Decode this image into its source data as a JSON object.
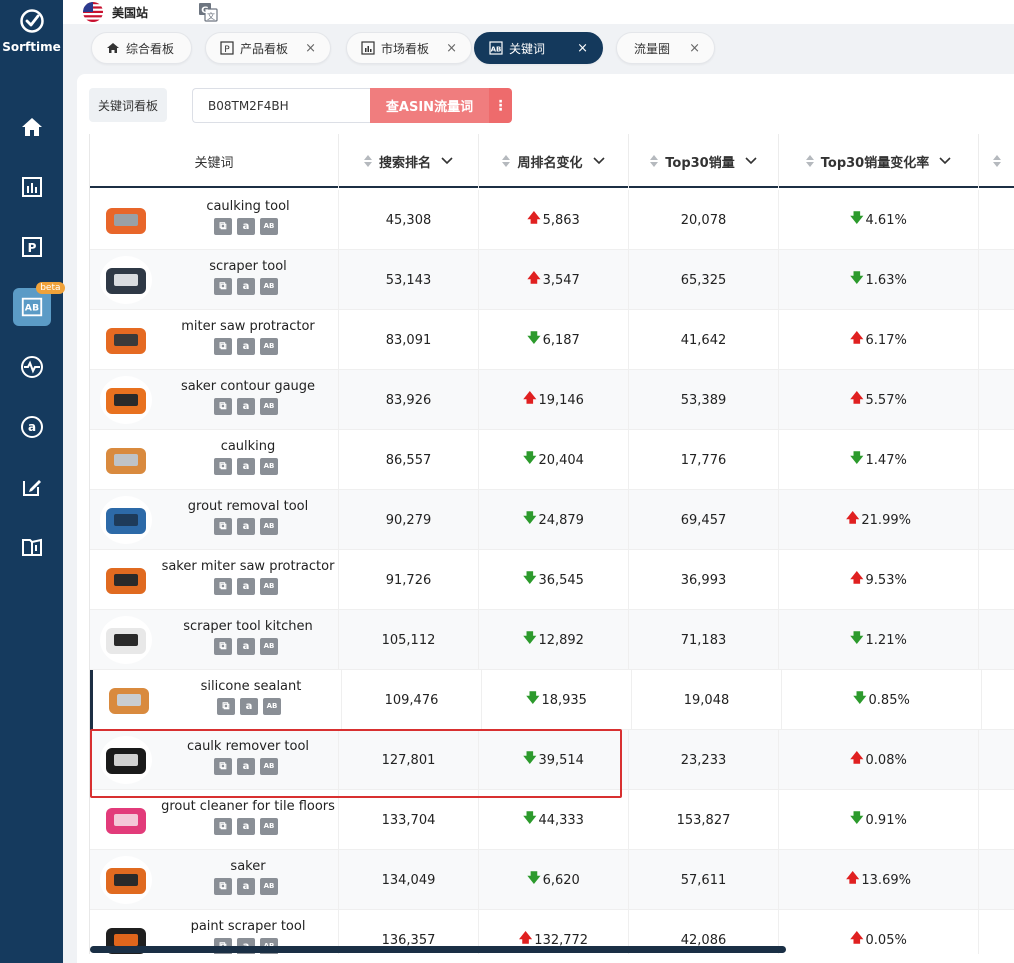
{
  "brand": {
    "name": "Sorftime"
  },
  "topbar": {
    "site": "美国站"
  },
  "tabs": [
    {
      "label": "综合看板",
      "icon": "home-icon",
      "closable": false,
      "active": false
    },
    {
      "label": "产品看板",
      "icon": "product-p-icon",
      "closable": true,
      "active": false
    },
    {
      "label": "市场看板",
      "icon": "chart-icon",
      "closable": true,
      "active": false
    },
    {
      "label": "关键词",
      "icon": "keyword-icon",
      "closable": true,
      "active": true
    },
    {
      "label": "流量圈",
      "icon": "",
      "closable": true,
      "active": false
    }
  ],
  "sidebar": {
    "items": [
      "home-icon",
      "bar-chart-icon",
      "product-p-icon",
      "keyword-ab-icon",
      "pulse-icon",
      "amazon-icon",
      "edit-icon",
      "book-icon"
    ],
    "beta_badge": "beta"
  },
  "toolbar": {
    "board_label": "关键词看板",
    "asin_value": "B08TM2F4BH",
    "asin_button": "查ASIN流量词",
    "more_label": "⋮"
  },
  "table": {
    "headers": [
      "关键词",
      "搜索排名",
      "周排名变化",
      "Top30销量",
      "Top30销量变化率"
    ],
    "rows": [
      {
        "keyword": "caulking tool",
        "rank": "45,308",
        "week_dir": "up",
        "week": "5,863",
        "top30": "20,078",
        "rate_dir": "down",
        "rate": "4.61%"
      },
      {
        "keyword": "scraper tool",
        "rank": "53,143",
        "week_dir": "up",
        "week": "3,547",
        "top30": "65,325",
        "rate_dir": "down",
        "rate": "1.63%"
      },
      {
        "keyword": "miter saw protractor",
        "rank": "83,091",
        "week_dir": "down",
        "week": "6,187",
        "top30": "41,642",
        "rate_dir": "up",
        "rate": "6.17%"
      },
      {
        "keyword": "saker contour gauge",
        "rank": "83,926",
        "week_dir": "up",
        "week": "19,146",
        "top30": "53,389",
        "rate_dir": "up",
        "rate": "5.57%"
      },
      {
        "keyword": "caulking",
        "rank": "86,557",
        "week_dir": "down",
        "week": "20,404",
        "top30": "17,776",
        "rate_dir": "down",
        "rate": "1.47%"
      },
      {
        "keyword": "grout removal tool",
        "rank": "90,279",
        "week_dir": "down",
        "week": "24,879",
        "top30": "69,457",
        "rate_dir": "up",
        "rate": "21.99%"
      },
      {
        "keyword": "saker miter saw protractor",
        "rank": "91,726",
        "week_dir": "down",
        "week": "36,545",
        "top30": "36,993",
        "rate_dir": "up",
        "rate": "9.53%"
      },
      {
        "keyword": "scraper tool kitchen",
        "rank": "105,112",
        "week_dir": "down",
        "week": "12,892",
        "top30": "71,183",
        "rate_dir": "down",
        "rate": "1.21%"
      },
      {
        "keyword": "silicone sealant",
        "rank": "109,476",
        "week_dir": "down",
        "week": "18,935",
        "top30": "19,048",
        "rate_dir": "down",
        "rate": "0.85%"
      },
      {
        "keyword": "caulk remover tool",
        "rank": "127,801",
        "week_dir": "down",
        "week": "39,514",
        "top30": "23,233",
        "rate_dir": "up",
        "rate": "0.08%"
      },
      {
        "keyword": "grout cleaner for tile floors",
        "rank": "133,704",
        "week_dir": "down",
        "week": "44,333",
        "top30": "153,827",
        "rate_dir": "down",
        "rate": "0.91%"
      },
      {
        "keyword": "saker",
        "rank": "134,049",
        "week_dir": "down",
        "week": "6,620",
        "top30": "57,611",
        "rate_dir": "up",
        "rate": "13.69%"
      },
      {
        "keyword": "paint scraper tool",
        "rank": "136,357",
        "week_dir": "up",
        "week": "132,772",
        "top30": "42,086",
        "rate_dir": "up",
        "rate": "0.05%"
      }
    ]
  },
  "colors": {
    "sidebar": "#153a5e",
    "accent": "#f07d7e",
    "up": "#e02020",
    "down": "#2c9a2c",
    "highlight": "#d83030"
  }
}
